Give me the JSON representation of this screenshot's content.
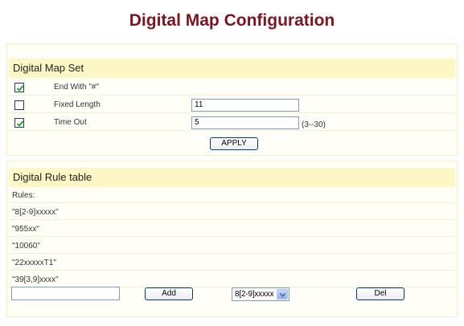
{
  "page": {
    "title": "Digital Map Configuration"
  },
  "map_set": {
    "header": "Digital Map Set",
    "rows": [
      {
        "label": "End With \"#\"",
        "checked": true
      },
      {
        "label": "Fixed Length",
        "checked": false,
        "value": "11"
      },
      {
        "label": "Time Out",
        "checked": true,
        "value": "5",
        "hint": "(3--30)"
      }
    ],
    "apply_label": "APPLY"
  },
  "rule_table": {
    "header": "Digital Rule table",
    "rules_label": "Rules:",
    "rules": [
      "\"8[2-9]xxxxx\"",
      "\"955xx\"",
      "\"10060\"",
      "\"22xxxxxT1\"",
      "\"39[3,9]xxxx\""
    ],
    "new_rule_value": "",
    "add_label": "Add",
    "selected_rule": "8[2-9]xxxxx",
    "del_label": "Del"
  },
  "colors": {
    "title": "#7a1521",
    "section_header_bg": "#fdf6c5",
    "panel_border": "#f3edc8"
  }
}
